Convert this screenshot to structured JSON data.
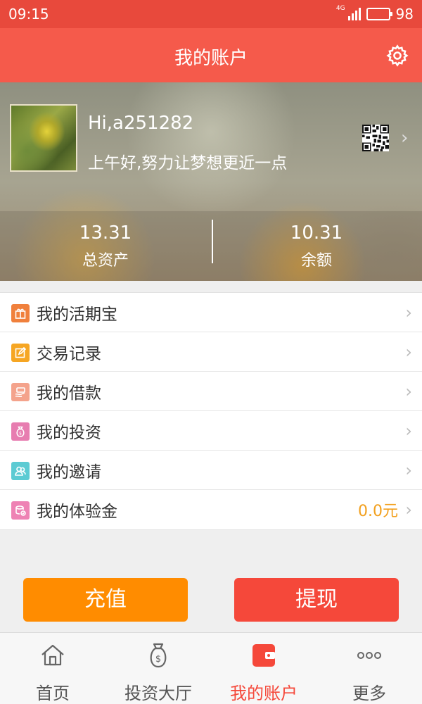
{
  "status_bar": {
    "time": "09:15",
    "network": "4G",
    "battery": "98"
  },
  "header": {
    "title": "我的账户",
    "settings_icon": "gear-icon"
  },
  "profile": {
    "greeting_name": "Hi,a251282",
    "greeting_message": "上午好,努力让梦想更近一点",
    "qr_icon": "qr-code-icon"
  },
  "stats": {
    "total_assets_value": "13.31",
    "total_assets_label": "总资产",
    "balance_value": "10.31",
    "balance_label": "余额"
  },
  "menu": {
    "items": [
      {
        "label": "我的活期宝",
        "icon": "gift-icon",
        "color": "#f0803c",
        "value": ""
      },
      {
        "label": "交易记录",
        "icon": "edit-icon",
        "color": "#f6a623",
        "value": ""
      },
      {
        "label": "我的借款",
        "icon": "cash-icon",
        "color": "#f4a38c",
        "value": ""
      },
      {
        "label": "我的投资",
        "icon": "money-bag-icon",
        "color": "#e77db0",
        "value": ""
      },
      {
        "label": "我的邀请",
        "icon": "users-icon",
        "color": "#5ccbd3",
        "value": ""
      },
      {
        "label": "我的体验金",
        "icon": "coins-icon",
        "color": "#ee82b4",
        "value": "0.0元"
      }
    ],
    "chevron": "›"
  },
  "actions": {
    "recharge_label": "充值",
    "withdraw_label": "提现"
  },
  "tabbar": {
    "items": [
      {
        "label": "首页",
        "icon": "home-icon",
        "active": false
      },
      {
        "label": "投资大厅",
        "icon": "money-bag-icon",
        "active": false
      },
      {
        "label": "我的账户",
        "icon": "wallet-icon",
        "active": true
      },
      {
        "label": "更多",
        "icon": "more-icon",
        "active": false
      }
    ]
  },
  "colors": {
    "header": "#f55a4b",
    "status_bar": "#e8493c",
    "accent_orange": "#ff8c00",
    "accent_red": "#f5483a",
    "value_orange": "#f2a01e"
  }
}
